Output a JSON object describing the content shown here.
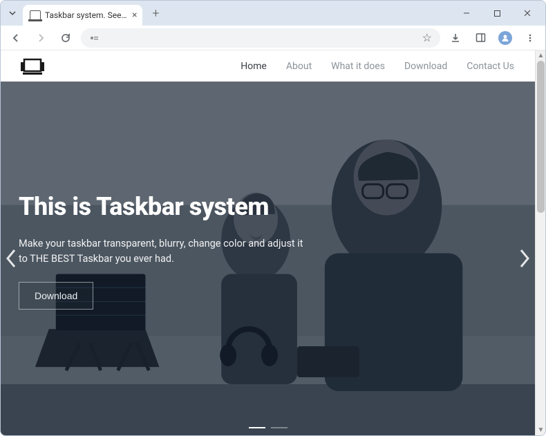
{
  "browser": {
    "tab_title": "Taskbar system. See more - do…",
    "window_controls": {
      "minimize": "minimize",
      "maximize": "maximize",
      "close": "close"
    }
  },
  "site": {
    "nav": [
      {
        "label": "Home",
        "active": true
      },
      {
        "label": "About",
        "active": false
      },
      {
        "label": "What it does",
        "active": false
      },
      {
        "label": "Download",
        "active": false
      },
      {
        "label": "Contact Us",
        "active": false
      }
    ]
  },
  "hero": {
    "title": "This is Taskbar system",
    "subtitle": "Make your taskbar transparent, blurry, change color and adjust it to THE BEST Taskbar you ever had.",
    "button_label": "Download",
    "slide_count": 2,
    "active_slide": 0
  }
}
